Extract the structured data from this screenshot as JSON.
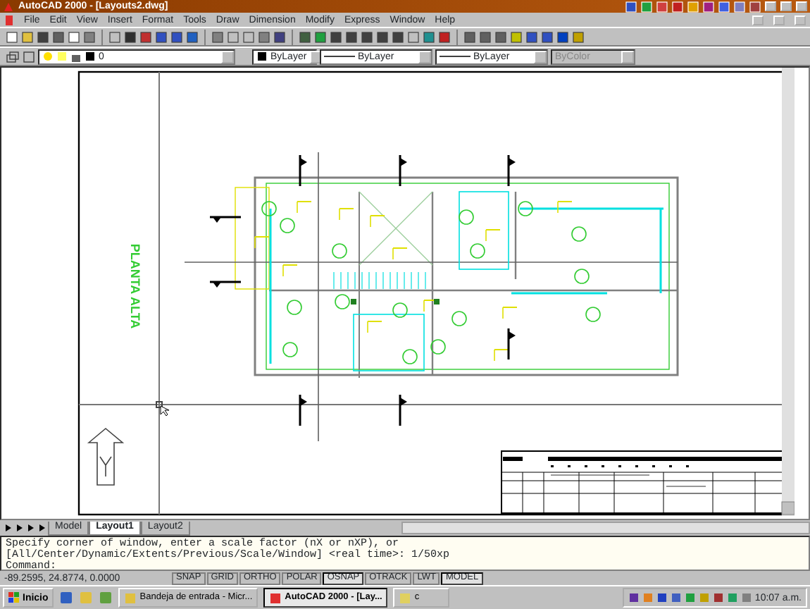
{
  "window": {
    "title": "AutoCAD 2000 - [Layouts2.dwg]"
  },
  "menu": [
    "File",
    "Edit",
    "View",
    "Insert",
    "Format",
    "Tools",
    "Draw",
    "Dimension",
    "Modify",
    "Express",
    "Window",
    "Help"
  ],
  "properties_toolbar": {
    "layer": "0",
    "color_setting": "ByLayer",
    "linetype": "ByLayer",
    "lineweight": "ByLayer",
    "plot_style": {
      "value": "ByColor",
      "disabled": true
    }
  },
  "drawing": {
    "label": "PLANTA ALTA"
  },
  "tabs": [
    {
      "label": "Model",
      "selected": false
    },
    {
      "label": "Layout1",
      "selected": true
    },
    {
      "label": "Layout2",
      "selected": false
    }
  ],
  "command_lines": [
    "Specify corner of window, enter a scale factor (nX or nXP), or",
    "[All/Center/Dynamic/Extents/Previous/Scale/Window] <real time>: 1/50xp",
    "Command:"
  ],
  "status_bar": {
    "coordinates": "-89.2595, 24.8774, 0.0000",
    "toggles": [
      {
        "label": "SNAP",
        "on": false
      },
      {
        "label": "GRID",
        "on": false
      },
      {
        "label": "ORTHO",
        "on": false
      },
      {
        "label": "POLAR",
        "on": false
      },
      {
        "label": "OSNAP",
        "on": true
      },
      {
        "label": "OTRACK",
        "on": false
      },
      {
        "label": "LWT",
        "on": false
      },
      {
        "label": "MODEL",
        "on": true
      }
    ]
  },
  "taskbar": {
    "start": "Inicio",
    "tasks": [
      {
        "label": "Bandeja de entrada - Micr...",
        "selected": false
      },
      {
        "label": "AutoCAD 2000 - [Lay...",
        "selected": true
      },
      {
        "label": "c",
        "selected": false
      }
    ],
    "clock": "10:07 a.m."
  }
}
